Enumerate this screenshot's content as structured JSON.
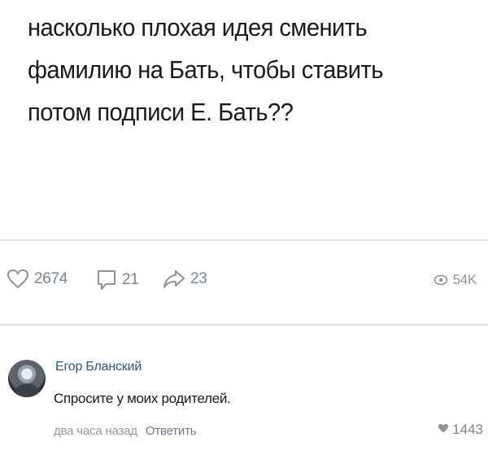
{
  "post": {
    "text": "насколько плохая идея сменить фамилию на Бать, чтобы ставить потом подписи Е. Бать??"
  },
  "actions": {
    "likes": "2674",
    "comments": "21",
    "shares": "23",
    "views": "54K",
    "icons": [
      "heart-icon",
      "comment-icon",
      "share-icon",
      "eye-icon"
    ]
  },
  "comment": {
    "author": "Егор Бланский",
    "text": "Спросите у моих родителей.",
    "time": "два часа назад",
    "reply_label": "Ответить",
    "likes": "1443"
  },
  "colors": {
    "author_link": "#2a5885",
    "muted": "#7b8592",
    "divider": "#dfe1e4"
  }
}
